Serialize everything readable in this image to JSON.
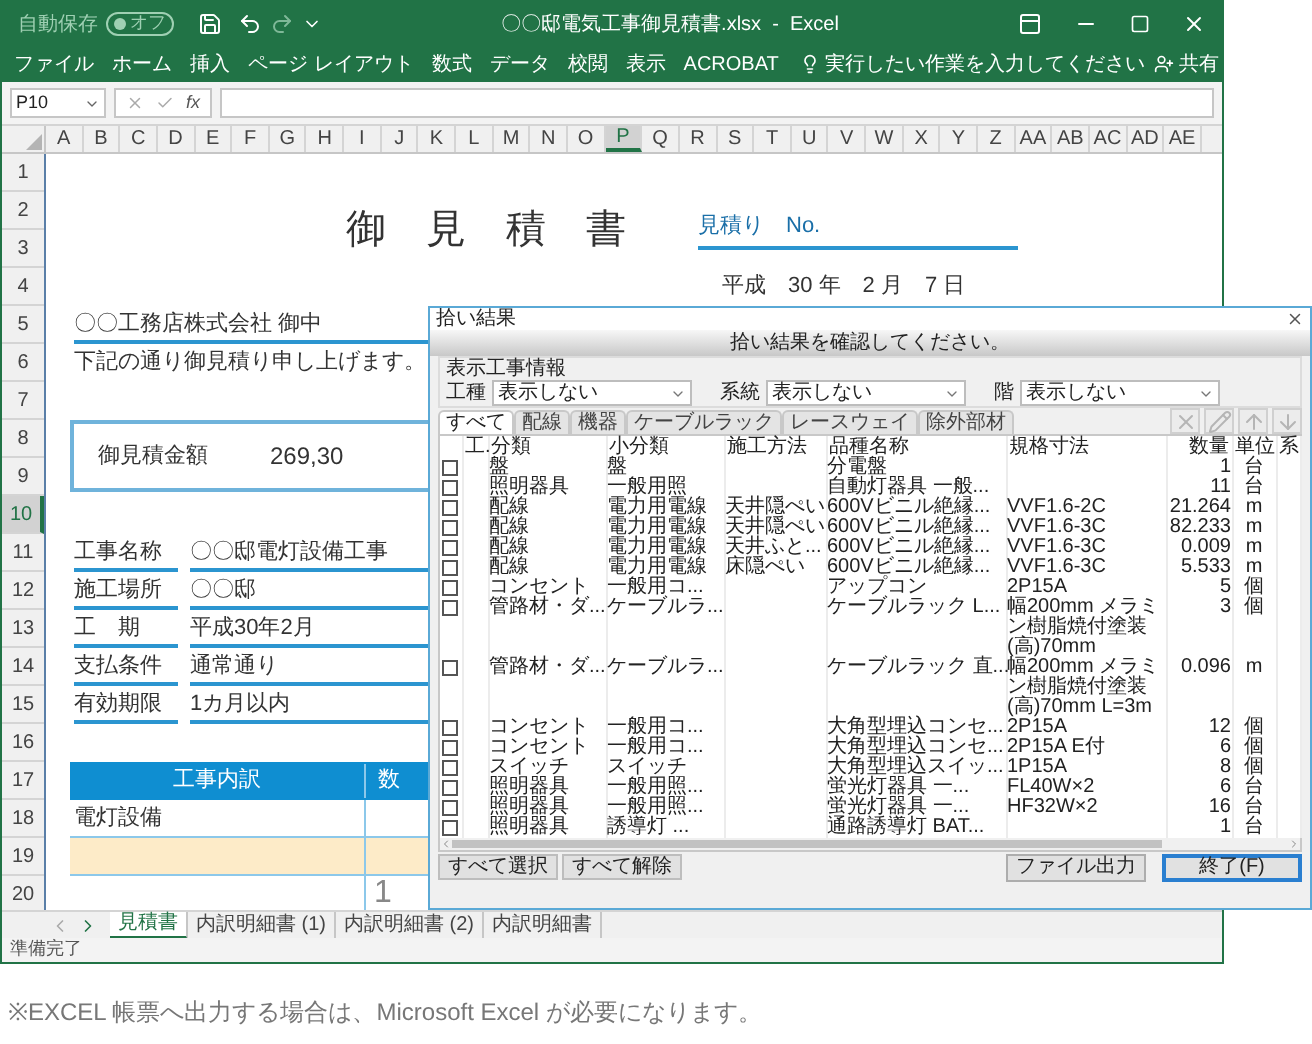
{
  "excel": {
    "autosave": {
      "label": "自動保存",
      "state": "オフ",
      "on": false
    },
    "title": "〇〇邸電気工事御見積書.xlsx  -  Excel",
    "ribbon_tabs": [
      "ファイル",
      "ホーム",
      "挿入",
      "ページ レイアウト",
      "数式",
      "データ",
      "校閲",
      "表示",
      "ACROBAT"
    ],
    "tell_me": "実行したい作業を入力してください",
    "share": "共有",
    "name_box": "P10",
    "formula_label": "fx",
    "columns": [
      {
        "label": "A",
        "selected": false
      },
      {
        "label": "B",
        "selected": false
      },
      {
        "label": "C",
        "selected": false
      },
      {
        "label": "D",
        "selected": false
      },
      {
        "label": "E",
        "selected": false
      },
      {
        "label": "F",
        "selected": false
      },
      {
        "label": "G",
        "selected": false
      },
      {
        "label": "H",
        "selected": false
      },
      {
        "label": "I",
        "selected": false
      },
      {
        "label": "J",
        "selected": false
      },
      {
        "label": "K",
        "selected": false
      },
      {
        "label": "L",
        "selected": false
      },
      {
        "label": "M",
        "selected": false
      },
      {
        "label": "N",
        "selected": false
      },
      {
        "label": "O",
        "selected": false
      },
      {
        "label": "P",
        "selected": true
      },
      {
        "label": "Q",
        "selected": false
      },
      {
        "label": "R",
        "selected": false
      },
      {
        "label": "S",
        "selected": false
      },
      {
        "label": "T",
        "selected": false
      },
      {
        "label": "U",
        "selected": false
      },
      {
        "label": "V",
        "selected": false
      },
      {
        "label": "W",
        "selected": false
      },
      {
        "label": "X",
        "selected": false
      },
      {
        "label": "Y",
        "selected": false
      },
      {
        "label": "Z",
        "selected": false
      },
      {
        "label": "AA",
        "selected": false
      },
      {
        "label": "AB",
        "selected": false
      },
      {
        "label": "AC",
        "selected": false
      },
      {
        "label": "AD",
        "selected": false
      },
      {
        "label": "AE",
        "selected": false
      }
    ],
    "rows": [
      {
        "label": "1",
        "selected": false
      },
      {
        "label": "2",
        "selected": false
      },
      {
        "label": "3",
        "selected": false
      },
      {
        "label": "4",
        "selected": false
      },
      {
        "label": "5",
        "selected": false
      },
      {
        "label": "6",
        "selected": false
      },
      {
        "label": "7",
        "selected": false
      },
      {
        "label": "8",
        "selected": false
      },
      {
        "label": "9",
        "selected": false
      },
      {
        "label": "10",
        "selected": true
      },
      {
        "label": "11",
        "selected": false
      },
      {
        "label": "12",
        "selected": false
      },
      {
        "label": "13",
        "selected": false
      },
      {
        "label": "14",
        "selected": false
      },
      {
        "label": "15",
        "selected": false
      },
      {
        "label": "16",
        "selected": false
      },
      {
        "label": "17",
        "selected": false
      },
      {
        "label": "18",
        "selected": false
      },
      {
        "label": "19",
        "selected": false
      },
      {
        "label": "20",
        "selected": false
      }
    ],
    "sheet": {
      "title": "御　見　積　書",
      "estimate_no": "見積り　No.",
      "date": "平成　30 年　2 月　7 日",
      "client": "〇〇工務店株式会社 御中",
      "greeting": "下記の通り御見積り申し上げます。",
      "total": {
        "label": "御見積金額",
        "value": "269,30"
      },
      "details": [
        {
          "label": "工事名称",
          "value": "〇〇邸電灯設備工事"
        },
        {
          "label": "施工場所",
          "value": "〇〇邸"
        },
        {
          "label": "工　期",
          "value": "平成30年2月"
        },
        {
          "label": "支払条件",
          "value": "通常通り"
        },
        {
          "label": "有効期限",
          "value": "1カ月以内"
        }
      ],
      "breakdown": {
        "header": "工事内訳",
        "header_2": "数",
        "rows": [
          {
            "item": "電灯設備",
            "highlighted": false
          },
          {
            "highlighted": true
          },
          {
            "quantity": "1",
            "highlighted": false
          }
        ]
      }
    },
    "sheet_tabs": [
      {
        "label": "見積書",
        "selected": true
      },
      {
        "label": "内訳明細書 (1)",
        "selected": false
      },
      {
        "label": "内訳明細書 (2)",
        "selected": false
      },
      {
        "label": "内訳明細書",
        "selected": false
      }
    ],
    "status": "準備完了"
  },
  "dialog": {
    "title": "拾い結果",
    "banner": "拾い結果を確認してください。",
    "group_label": "表示工事情報",
    "filters": [
      {
        "label": "工種",
        "value": "表示しない"
      },
      {
        "label": "系統",
        "value": "表示しない"
      },
      {
        "label": "階",
        "value": "表示しない"
      }
    ],
    "tabs": [
      {
        "label": "すべて",
        "selected": true
      },
      {
        "label": "配線",
        "selected": false
      },
      {
        "label": "機器",
        "selected": false
      },
      {
        "label": "ケーブルラック",
        "selected": false
      },
      {
        "label": "レースウェイ",
        "selected": false
      },
      {
        "label": "除外部材",
        "selected": false
      }
    ],
    "toolbar": [
      {
        "kind": "delete",
        "disabled": true
      },
      {
        "kind": "edit",
        "disabled": true
      },
      {
        "kind": "up",
        "disabled": true
      },
      {
        "kind": "down",
        "disabled": true
      }
    ],
    "columns": [
      "工.",
      "分類",
      "小分類",
      "施工方法",
      "品種名称",
      "規格寸法",
      "数量",
      "単位",
      "系"
    ],
    "rows": [
      {
        "checked": false,
        "cells": [
          "",
          "盤",
          "盤",
          "",
          "分電盤",
          "",
          "1",
          "台",
          ""
        ]
      },
      {
        "checked": false,
        "cells": [
          "",
          "照明器具",
          "一般用照",
          "",
          "自動灯器具 一般...",
          "",
          "11",
          "台",
          ""
        ]
      },
      {
        "checked": false,
        "cells": [
          "",
          "配線",
          "電力用電線",
          "天井隠ぺい",
          "600Vビニル絶縁...",
          "VVF1.6-2C",
          "21.264",
          "m",
          ""
        ]
      },
      {
        "checked": false,
        "cells": [
          "",
          "配線",
          "電力用電線",
          "天井隠ぺい",
          "600Vビニル絶縁...",
          "VVF1.6-3C",
          "82.233",
          "m",
          ""
        ]
      },
      {
        "checked": false,
        "cells": [
          "",
          "配線",
          "電力用電線",
          "天井ふと...",
          "600Vビニル絶縁...",
          "VVF1.6-3C",
          "0.009",
          "m",
          ""
        ]
      },
      {
        "checked": false,
        "cells": [
          "",
          "配線",
          "電力用電線",
          "床隠ぺい",
          "600Vビニル絶縁...",
          "VVF1.6-3C",
          "5.533",
          "m",
          ""
        ]
      },
      {
        "checked": false,
        "cells": [
          "",
          "コンセント",
          "一般用コ...",
          "",
          "アップコン",
          "2P15A",
          "5",
          "個",
          ""
        ]
      },
      {
        "checked": false,
        "cells": [
          "",
          "管路材・ダ...",
          "ケーブルラ...",
          "",
          "ケーブルラック L...",
          "幅200mm メラミン樹脂焼付塗装(高)70mm",
          "3",
          "個",
          ""
        ]
      },
      {
        "checked": false,
        "cells": [
          "",
          "管路材・ダ...",
          "ケーブルラ...",
          "",
          "ケーブルラック 直...",
          "幅200mm メラミン樹脂焼付塗装(高)70mm L=3m",
          "0.096",
          "m",
          ""
        ]
      },
      {
        "checked": false,
        "cells": [
          "",
          "コンセント",
          "一般用コ...",
          "",
          "大角型埋込コンセ...",
          "2P15A",
          "12",
          "個",
          ""
        ]
      },
      {
        "checked": false,
        "cells": [
          "",
          "コンセント",
          "一般用コ...",
          "",
          "大角型埋込コンセ...",
          "2P15A E付",
          "6",
          "個",
          ""
        ]
      },
      {
        "checked": false,
        "cells": [
          "",
          "スイッチ",
          "スイッチ",
          "",
          "大角型埋込スイッ...",
          "1P15A",
          "8",
          "個",
          ""
        ]
      },
      {
        "checked": false,
        "cells": [
          "",
          "照明器具",
          "一般用照...",
          "",
          "蛍光灯器具 一...",
          "FL40W×2",
          "6",
          "台",
          ""
        ]
      },
      {
        "checked": false,
        "cells": [
          "",
          "照明器具",
          "一般用照...",
          "",
          "蛍光灯器具 一...",
          "HF32W×2",
          "16",
          "台",
          ""
        ]
      },
      {
        "checked": false,
        "cells": [
          "",
          "照明器具",
          "誘導灯 ...",
          "",
          "通路誘導灯 BAT...",
          "",
          "1",
          "台",
          ""
        ]
      }
    ],
    "select_buttons": [
      "すべて選択",
      "すべて解除"
    ],
    "buttons": [
      {
        "label": "ファイル出力",
        "default": false
      },
      {
        "label": "終了(F)",
        "default": true
      }
    ]
  },
  "note": "※EXCEL 帳票へ出力する場合は、Microsoft Excel が必要になります。"
}
